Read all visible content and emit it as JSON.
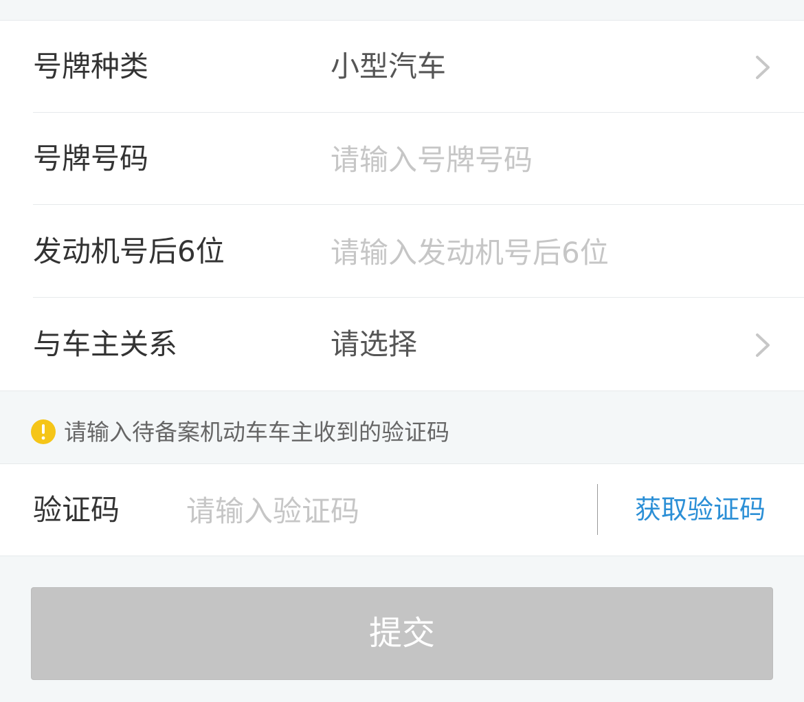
{
  "form": {
    "rows": [
      {
        "label": "号牌种类",
        "value": "小型汽车"
      },
      {
        "label": "号牌号码",
        "placeholder": "请输入号牌号码"
      },
      {
        "label": "发动机号后6位",
        "placeholder": "请输入发动机号后6位"
      },
      {
        "label": "与车主关系",
        "value": "请选择"
      }
    ]
  },
  "notice": {
    "icon": "exclamation-icon",
    "color": "#f5c518",
    "text": "请输入待备案机动车车主收到的验证码"
  },
  "verification": {
    "label": "验证码",
    "placeholder": "请输入验证码",
    "get_code_label": "获取验证码",
    "link_color": "#2b8fd6"
  },
  "submit": {
    "label": "提交",
    "state": "disabled"
  },
  "icons": {
    "row_chevron": "chevron-right-icon"
  }
}
